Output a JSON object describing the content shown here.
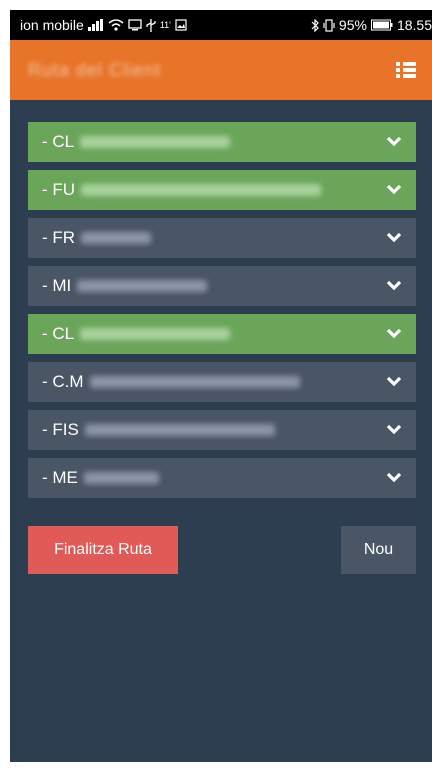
{
  "status_bar": {
    "carrier": "ion mobile",
    "usb_speed": "11'",
    "battery_percent": "95%",
    "time": "18.55"
  },
  "app_bar": {
    "title": "Ruta del Client",
    "menu_icon": "list-icon"
  },
  "colors": {
    "appbar": "#e8742a",
    "background": "#2c3e50",
    "item_green": "#6aa55a",
    "item_grey": "#4a5566",
    "finish_button": "#e05a57"
  },
  "items": [
    {
      "prefix": "- CL",
      "color": "green"
    },
    {
      "prefix": "- FU",
      "color": "green"
    },
    {
      "prefix": "- FR",
      "color": "grey"
    },
    {
      "prefix": "- MI",
      "color": "grey"
    },
    {
      "prefix": "- CL",
      "color": "green"
    },
    {
      "prefix": "- C.M",
      "color": "grey"
    },
    {
      "prefix": "- FIS",
      "color": "grey"
    },
    {
      "prefix": "- ME",
      "color": "grey"
    }
  ],
  "actions": {
    "finish_label": "Finalitza Ruta",
    "new_label": "Nou"
  }
}
